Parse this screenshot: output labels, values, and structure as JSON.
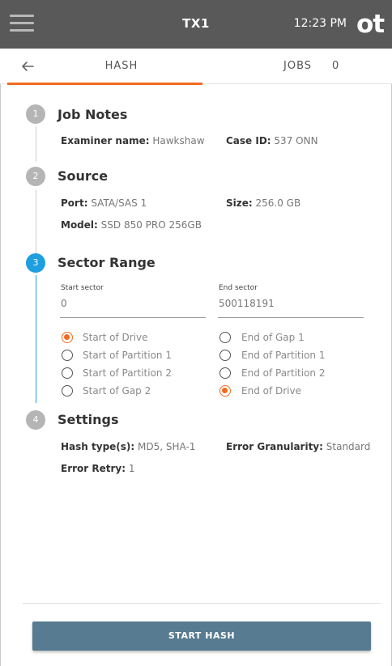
{
  "header": {
    "device_name": "TX1",
    "time": "12:23 PM",
    "logo_text": "ot"
  },
  "tabs": {
    "hash_label": "HASH",
    "jobs_label": "JOBS",
    "jobs_count": "0"
  },
  "steps": {
    "job_notes": {
      "number": "1",
      "title": "Job Notes",
      "examiner_label": "Examiner name:",
      "examiner_value": "Hawkshaw",
      "case_label": "Case ID:",
      "case_value": "537 ONN"
    },
    "source": {
      "number": "2",
      "title": "Source",
      "port_label": "Port:",
      "port_value": "SATA/SAS 1",
      "size_label": "Size:",
      "size_value": "256.0 GB",
      "model_label": "Model:",
      "model_value": "SSD 850 PRO 256GB"
    },
    "sector_range": {
      "number": "3",
      "title": "Sector Range",
      "start_label": "Start sector",
      "start_value": "0",
      "end_label": "End sector",
      "end_value": "500118191",
      "start_options": [
        {
          "label": "Start of Drive",
          "checked": true
        },
        {
          "label": "Start of Partition 1",
          "checked": false
        },
        {
          "label": "Start of Partition 2",
          "checked": false
        },
        {
          "label": "Start of Gap 2",
          "checked": false
        }
      ],
      "end_options": [
        {
          "label": "End of Gap 1",
          "checked": false
        },
        {
          "label": "End of Partition 1",
          "checked": false
        },
        {
          "label": "End of Partition 2",
          "checked": false
        },
        {
          "label": "End of Drive",
          "checked": true
        }
      ]
    },
    "settings": {
      "number": "4",
      "title": "Settings",
      "hash_label": "Hash type(s):",
      "hash_value": "MD5, SHA-1",
      "granularity_label": "Error Granularity:",
      "granularity_value": "Standard",
      "retry_label": "Error Retry:",
      "retry_value": "1"
    }
  },
  "footer": {
    "start_button_label": "START HASH"
  },
  "colors": {
    "accent": "#f26b21",
    "active_step": "#1e9fe0",
    "topbar": "#595959",
    "button": "#577b90"
  },
  "icons": {
    "menu": "hamburger-menu-icon",
    "back": "arrow-left-icon"
  }
}
